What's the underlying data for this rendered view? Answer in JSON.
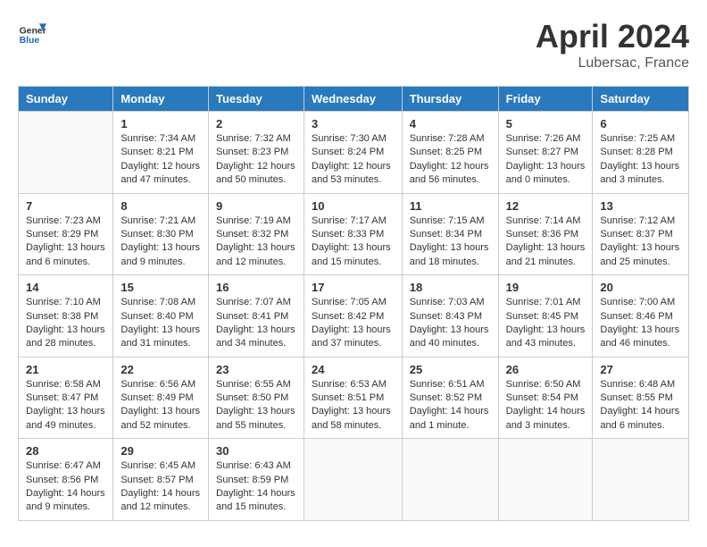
{
  "header": {
    "logo_line1": "General",
    "logo_line2": "Blue",
    "month_year": "April 2024",
    "location": "Lubersac, France"
  },
  "columns": [
    "Sunday",
    "Monday",
    "Tuesday",
    "Wednesday",
    "Thursday",
    "Friday",
    "Saturday"
  ],
  "weeks": [
    [
      {
        "day": "",
        "info": ""
      },
      {
        "day": "1",
        "info": "Sunrise: 7:34 AM\nSunset: 8:21 PM\nDaylight: 12 hours\nand 47 minutes."
      },
      {
        "day": "2",
        "info": "Sunrise: 7:32 AM\nSunset: 8:23 PM\nDaylight: 12 hours\nand 50 minutes."
      },
      {
        "day": "3",
        "info": "Sunrise: 7:30 AM\nSunset: 8:24 PM\nDaylight: 12 hours\nand 53 minutes."
      },
      {
        "day": "4",
        "info": "Sunrise: 7:28 AM\nSunset: 8:25 PM\nDaylight: 12 hours\nand 56 minutes."
      },
      {
        "day": "5",
        "info": "Sunrise: 7:26 AM\nSunset: 8:27 PM\nDaylight: 13 hours\nand 0 minutes."
      },
      {
        "day": "6",
        "info": "Sunrise: 7:25 AM\nSunset: 8:28 PM\nDaylight: 13 hours\nand 3 minutes."
      }
    ],
    [
      {
        "day": "7",
        "info": "Sunrise: 7:23 AM\nSunset: 8:29 PM\nDaylight: 13 hours\nand 6 minutes."
      },
      {
        "day": "8",
        "info": "Sunrise: 7:21 AM\nSunset: 8:30 PM\nDaylight: 13 hours\nand 9 minutes."
      },
      {
        "day": "9",
        "info": "Sunrise: 7:19 AM\nSunset: 8:32 PM\nDaylight: 13 hours\nand 12 minutes."
      },
      {
        "day": "10",
        "info": "Sunrise: 7:17 AM\nSunset: 8:33 PM\nDaylight: 13 hours\nand 15 minutes."
      },
      {
        "day": "11",
        "info": "Sunrise: 7:15 AM\nSunset: 8:34 PM\nDaylight: 13 hours\nand 18 minutes."
      },
      {
        "day": "12",
        "info": "Sunrise: 7:14 AM\nSunset: 8:36 PM\nDaylight: 13 hours\nand 21 minutes."
      },
      {
        "day": "13",
        "info": "Sunrise: 7:12 AM\nSunset: 8:37 PM\nDaylight: 13 hours\nand 25 minutes."
      }
    ],
    [
      {
        "day": "14",
        "info": "Sunrise: 7:10 AM\nSunset: 8:38 PM\nDaylight: 13 hours\nand 28 minutes."
      },
      {
        "day": "15",
        "info": "Sunrise: 7:08 AM\nSunset: 8:40 PM\nDaylight: 13 hours\nand 31 minutes."
      },
      {
        "day": "16",
        "info": "Sunrise: 7:07 AM\nSunset: 8:41 PM\nDaylight: 13 hours\nand 34 minutes."
      },
      {
        "day": "17",
        "info": "Sunrise: 7:05 AM\nSunset: 8:42 PM\nDaylight: 13 hours\nand 37 minutes."
      },
      {
        "day": "18",
        "info": "Sunrise: 7:03 AM\nSunset: 8:43 PM\nDaylight: 13 hours\nand 40 minutes."
      },
      {
        "day": "19",
        "info": "Sunrise: 7:01 AM\nSunset: 8:45 PM\nDaylight: 13 hours\nand 43 minutes."
      },
      {
        "day": "20",
        "info": "Sunrise: 7:00 AM\nSunset: 8:46 PM\nDaylight: 13 hours\nand 46 minutes."
      }
    ],
    [
      {
        "day": "21",
        "info": "Sunrise: 6:58 AM\nSunset: 8:47 PM\nDaylight: 13 hours\nand 49 minutes."
      },
      {
        "day": "22",
        "info": "Sunrise: 6:56 AM\nSunset: 8:49 PM\nDaylight: 13 hours\nand 52 minutes."
      },
      {
        "day": "23",
        "info": "Sunrise: 6:55 AM\nSunset: 8:50 PM\nDaylight: 13 hours\nand 55 minutes."
      },
      {
        "day": "24",
        "info": "Sunrise: 6:53 AM\nSunset: 8:51 PM\nDaylight: 13 hours\nand 58 minutes."
      },
      {
        "day": "25",
        "info": "Sunrise: 6:51 AM\nSunset: 8:52 PM\nDaylight: 14 hours\nand 1 minute."
      },
      {
        "day": "26",
        "info": "Sunrise: 6:50 AM\nSunset: 8:54 PM\nDaylight: 14 hours\nand 3 minutes."
      },
      {
        "day": "27",
        "info": "Sunrise: 6:48 AM\nSunset: 8:55 PM\nDaylight: 14 hours\nand 6 minutes."
      }
    ],
    [
      {
        "day": "28",
        "info": "Sunrise: 6:47 AM\nSunset: 8:56 PM\nDaylight: 14 hours\nand 9 minutes."
      },
      {
        "day": "29",
        "info": "Sunrise: 6:45 AM\nSunset: 8:57 PM\nDaylight: 14 hours\nand 12 minutes."
      },
      {
        "day": "30",
        "info": "Sunrise: 6:43 AM\nSunset: 8:59 PM\nDaylight: 14 hours\nand 15 minutes."
      },
      {
        "day": "",
        "info": ""
      },
      {
        "day": "",
        "info": ""
      },
      {
        "day": "",
        "info": ""
      },
      {
        "day": "",
        "info": ""
      }
    ]
  ]
}
